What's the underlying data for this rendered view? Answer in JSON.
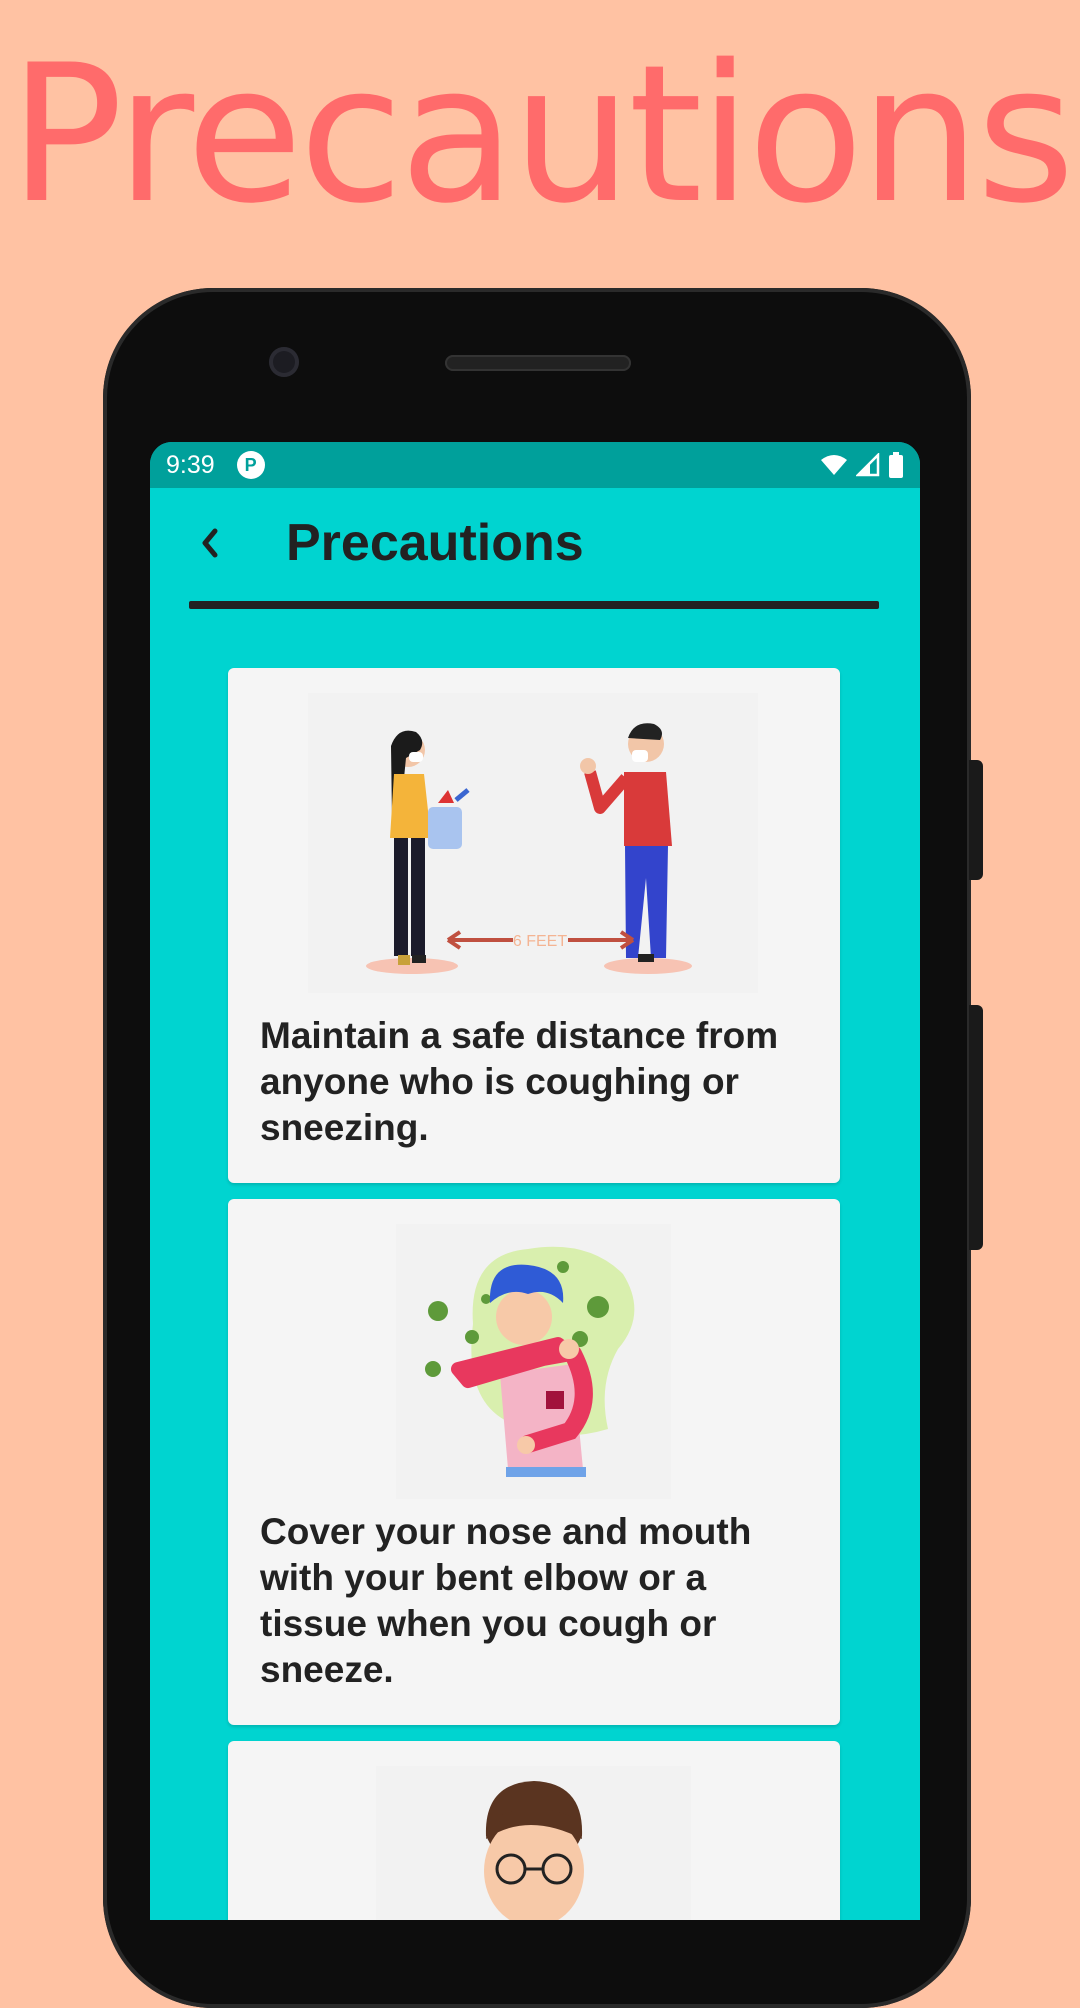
{
  "promo": {
    "title": "Precautions"
  },
  "status_bar": {
    "time": "9:39",
    "app_badge": "P"
  },
  "toolbar": {
    "title": "Precautions"
  },
  "cards": [
    {
      "text": "Maintain a safe distance from anyone who is coughing or sneezing.",
      "image_label": "6 FEET"
    },
    {
      "text": "Cover your nose and mouth with your bent elbow or a tissue when you cough or sneeze."
    },
    {
      "text": ""
    }
  ],
  "colors": {
    "background": "#FFC2A3",
    "promo_title": "#FF6B6B",
    "screen": "#00D4D0",
    "status_bar": "#00A09B",
    "card": "#F5F5F5"
  }
}
